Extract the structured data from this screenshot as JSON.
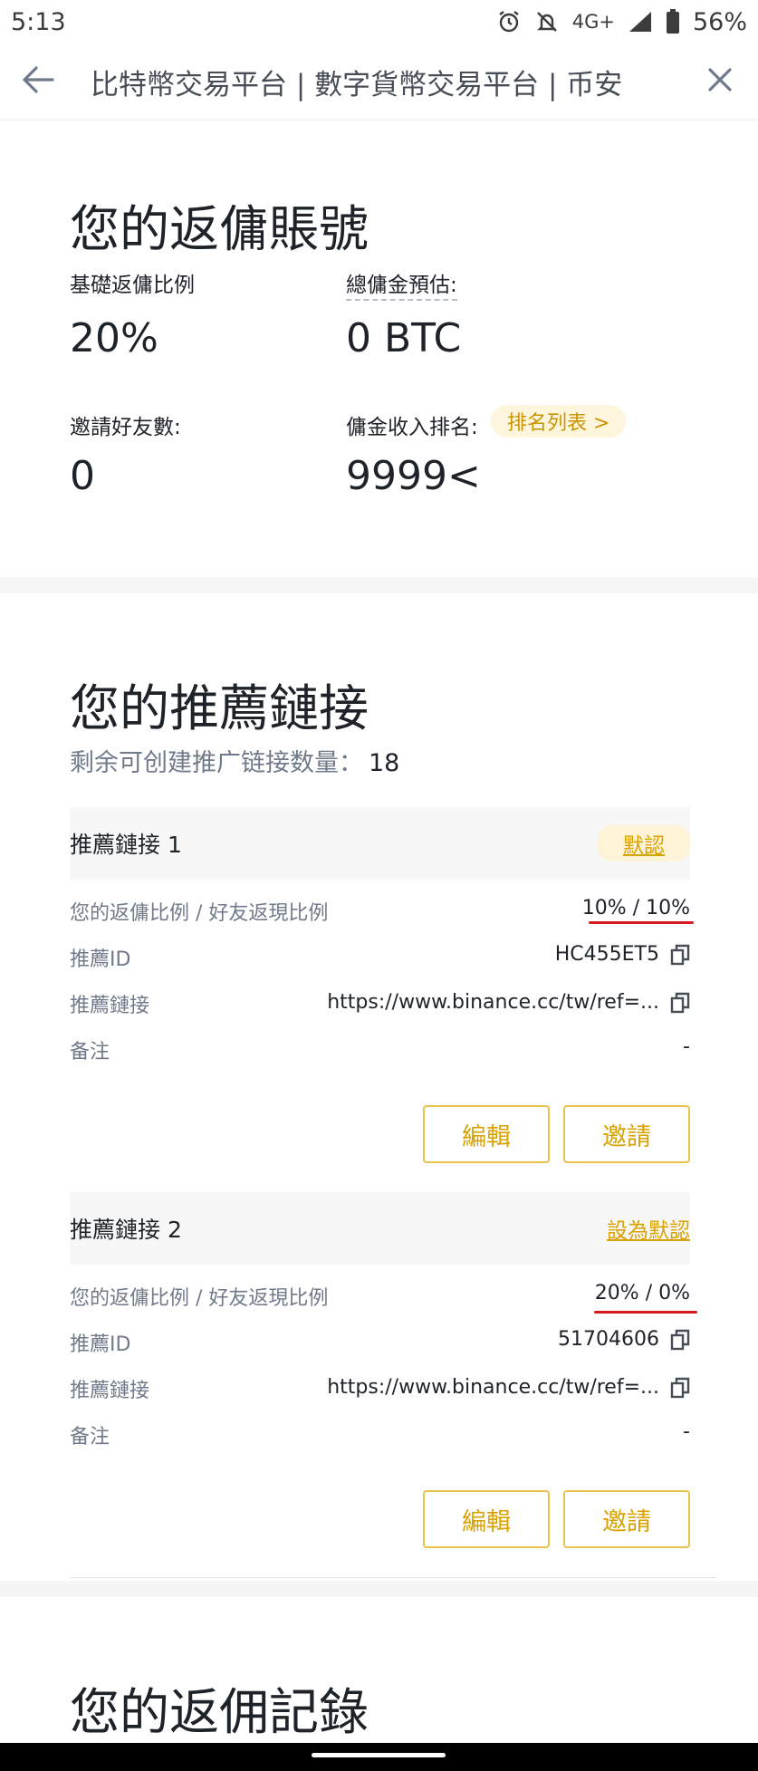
{
  "status_bar": {
    "time": "5:13",
    "network": "4G+",
    "battery": "56%",
    "icons": [
      "alarm-icon",
      "bell-off-icon",
      "signal-icon",
      "battery-icon"
    ]
  },
  "browser": {
    "title": "比特幣交易平台 | 數字貨幣交易平台 | 币安",
    "back_icon": "arrow-left-icon",
    "close_icon": "close-icon"
  },
  "rebate_account": {
    "title": "您的返傭賬號",
    "base_ratio_label": "基礎返傭比例",
    "base_ratio_value": "20%",
    "estimate_label": "總傭金預估:",
    "estimate_value": "0 BTC",
    "invited_label": "邀請好友數:",
    "invited_value": "0",
    "ranking_label": "傭金收入排名:",
    "ranking_link": "排名列表 >",
    "ranking_value": "9999<"
  },
  "referral_links": {
    "title": "您的推薦鏈接",
    "remaining_label": "剩余可创建推广链接数量：",
    "remaining_value": "18",
    "items": [
      {
        "name": "推薦鏈接 1",
        "status": "默認",
        "ratio_label": "您的返傭比例 / 好友返現比例",
        "ratio_value": "10% / 10%",
        "id_label": "推薦ID",
        "id_value": "HC455ET5",
        "link_label": "推薦鏈接",
        "link_value": "https://www.binance.cc/tw/ref=...",
        "note_label": "备注",
        "note_value": "-",
        "edit_label": "編輯",
        "invite_label": "邀請"
      },
      {
        "name": "推薦鏈接 2",
        "status": "設為默認",
        "ratio_label": "您的返傭比例 / 好友返現比例",
        "ratio_value": "20% / 0%",
        "id_label": "推薦ID",
        "id_value": "51704606",
        "link_label": "推薦鏈接",
        "link_value": "https://www.binance.cc/tw/ref=...",
        "note_label": "备注",
        "note_value": "-",
        "edit_label": "編輯",
        "invite_label": "邀請"
      }
    ]
  },
  "rebate_records": {
    "title": "您的返佣記錄"
  },
  "colors": {
    "accent": "#d8a200",
    "annotation_red": "#d71920",
    "text_primary": "#1e2329",
    "text_secondary": "#707a8a"
  }
}
